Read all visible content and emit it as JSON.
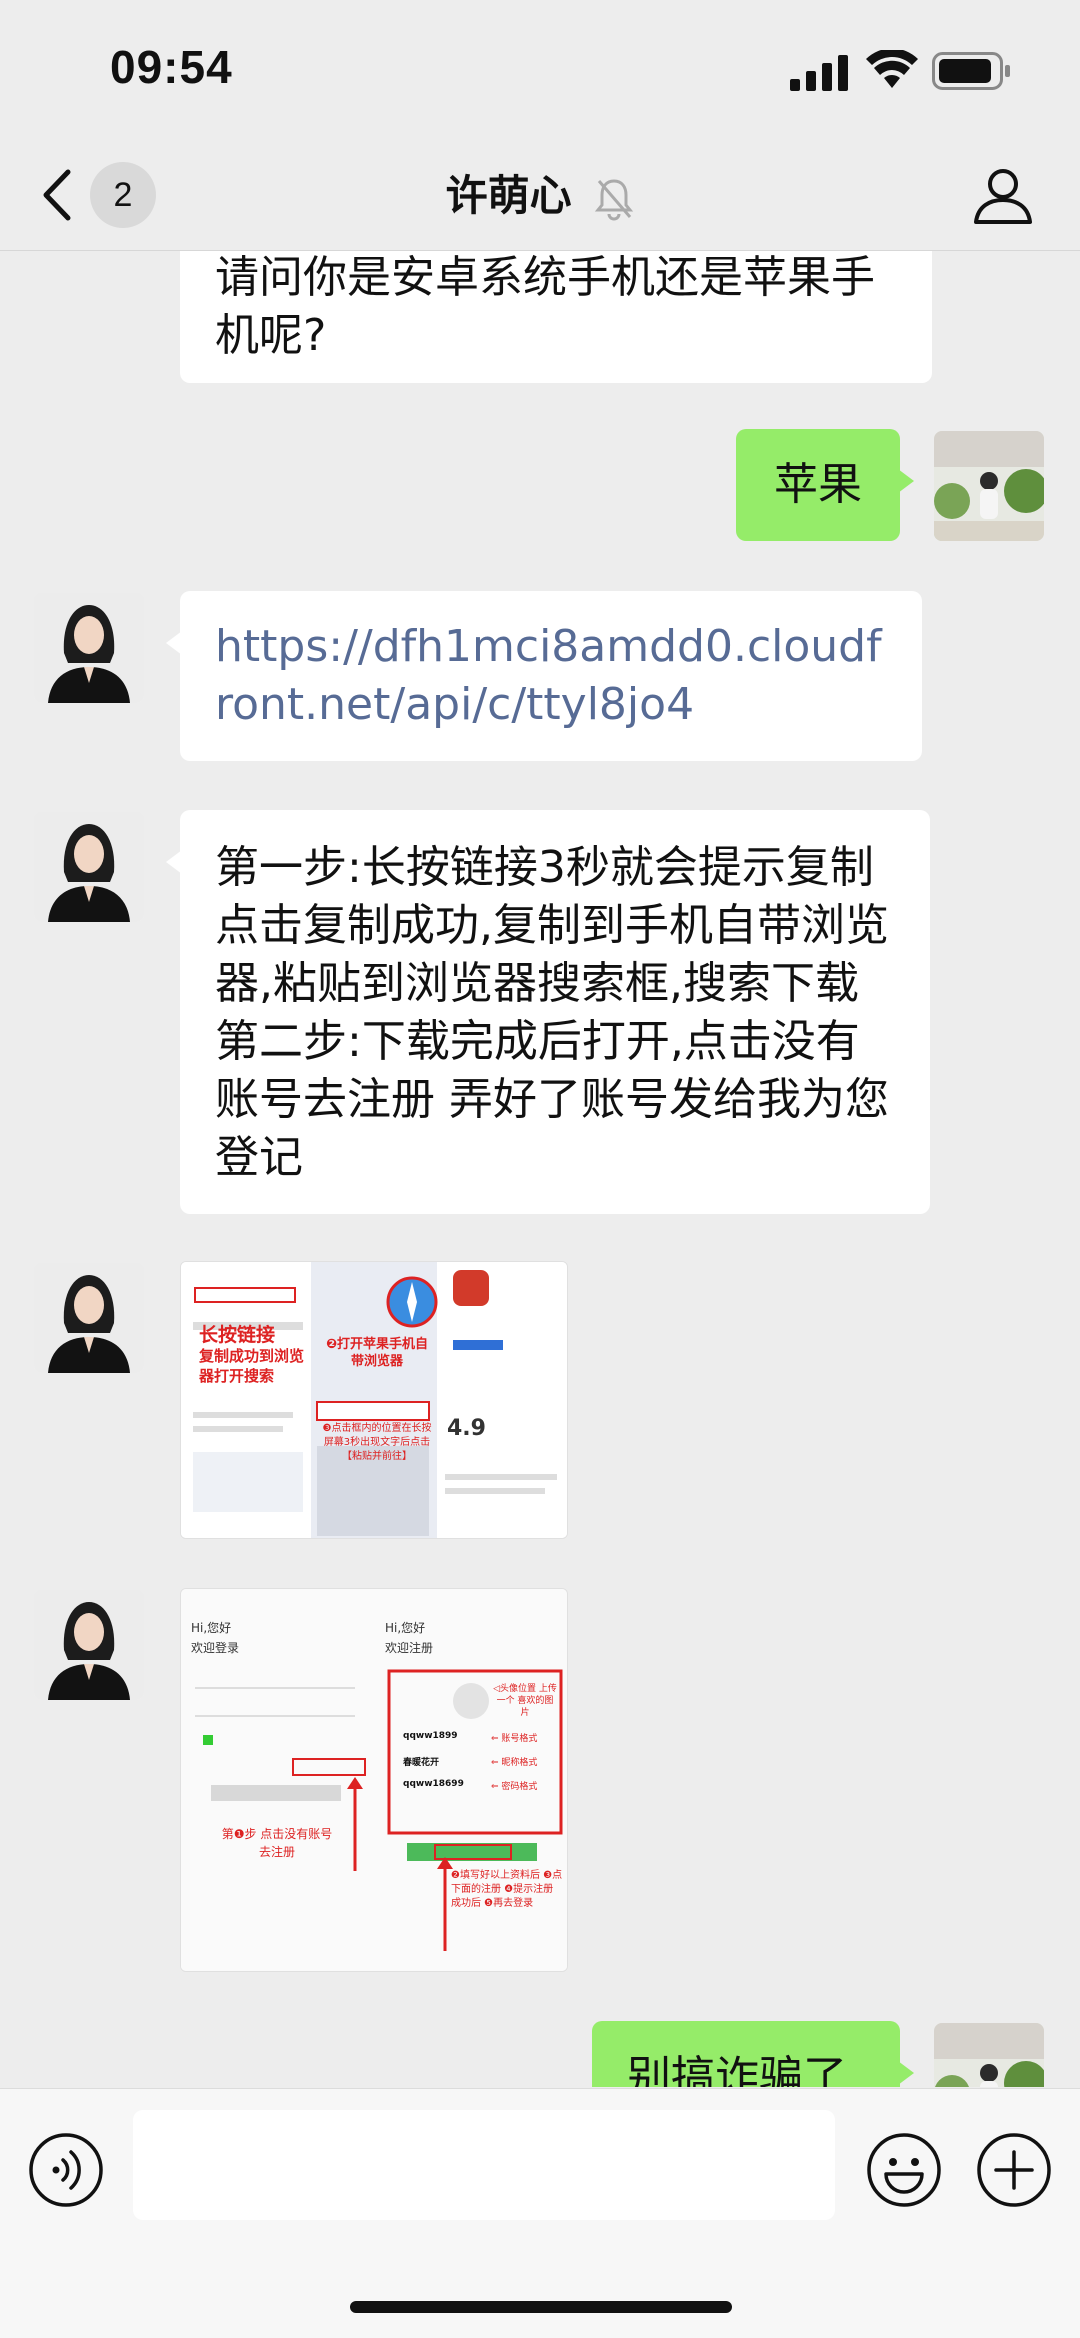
{
  "status_bar": {
    "time": "09:54"
  },
  "nav": {
    "unread_count": "2",
    "title": "许萌心"
  },
  "messages": {
    "m1_text": "请问你是安卓系统手机还是苹果手机呢?",
    "m2_text": "苹果",
    "m3_link": "https://dfh1mci8amdd0.cloudfront.net/api/c/ttyl8jo4",
    "m4_text": "第一步:长按链接3秒就会提示复制点击复制成功,复制到手机自带浏览器,粘贴到浏览器搜索框,搜索下载 第二步:下载完成后打开,点击没有账号去注册 弄好了账号发给我为您登记",
    "m5_image": {
      "caption1": "长按链接",
      "caption2": "复制成功到浏览器打开搜索",
      "caption3": "❷打开苹果手机自带浏览器",
      "caption4": "❸点击框内的位置在长按屏幕3秒出现文字后点击【粘贴并前往】",
      "rating": "4.9"
    },
    "m6_image": {
      "left_greeting": "Hi,您好",
      "left_sub": "欢迎登录",
      "left_step": "第❶步 点击没有账号去注册",
      "right_greeting": "Hi,您好",
      "right_sub": "欢迎注册",
      "avatar_note": "◁头像位置 上传一个 喜欢的图片",
      "acc": "qqww1899",
      "acc_label": "⇐ 账号格式",
      "nick": "春暖花开",
      "nick_label": "⇐ 昵称格式",
      "pwd": "qqww18699",
      "pwd_label": "⇐ 密码格式",
      "steps": "❷填写好以上资料后 ❸点下面的注册 ❹提示注册成功后 ❺再去登录"
    },
    "m7_text": "别搞诈骗了"
  },
  "colors": {
    "bg": "#ededed",
    "self_bubble": "#95ec69",
    "link": "#576b95"
  },
  "icons": [
    "back-icon",
    "mute-bell-icon",
    "profile-icon",
    "voice-icon",
    "emoji-icon",
    "plus-icon"
  ]
}
